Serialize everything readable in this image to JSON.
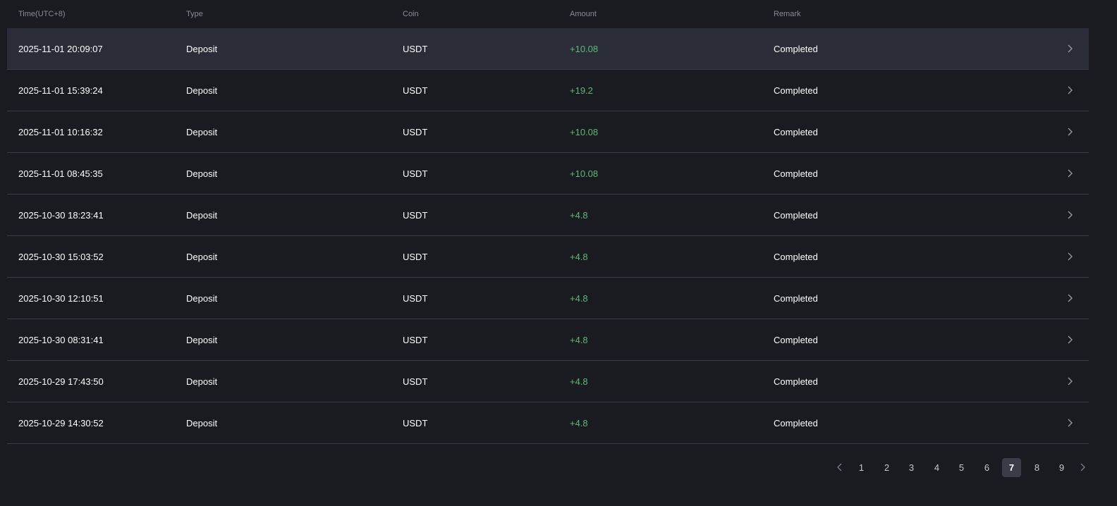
{
  "headers": {
    "time": "Time(UTC+8)",
    "type": "Type",
    "coin": "Coin",
    "amount": "Amount",
    "remark": "Remark"
  },
  "rows": [
    {
      "time": "2025-11-01 20:09:07",
      "type": "Deposit",
      "coin": "USDT",
      "amount": "+10.08",
      "remark": "Completed"
    },
    {
      "time": "2025-11-01 15:39:24",
      "type": "Deposit",
      "coin": "USDT",
      "amount": "+19.2",
      "remark": "Completed"
    },
    {
      "time": "2025-11-01 10:16:32",
      "type": "Deposit",
      "coin": "USDT",
      "amount": "+10.08",
      "remark": "Completed"
    },
    {
      "time": "2025-11-01 08:45:35",
      "type": "Deposit",
      "coin": "USDT",
      "amount": "+10.08",
      "remark": "Completed"
    },
    {
      "time": "2025-10-30 18:23:41",
      "type": "Deposit",
      "coin": "USDT",
      "amount": "+4.8",
      "remark": "Completed"
    },
    {
      "time": "2025-10-30 15:03:52",
      "type": "Deposit",
      "coin": "USDT",
      "amount": "+4.8",
      "remark": "Completed"
    },
    {
      "time": "2025-10-30 12:10:51",
      "type": "Deposit",
      "coin": "USDT",
      "amount": "+4.8",
      "remark": "Completed"
    },
    {
      "time": "2025-10-30 08:31:41",
      "type": "Deposit",
      "coin": "USDT",
      "amount": "+4.8",
      "remark": "Completed"
    },
    {
      "time": "2025-10-29 17:43:50",
      "type": "Deposit",
      "coin": "USDT",
      "amount": "+4.8",
      "remark": "Completed"
    },
    {
      "time": "2025-10-29 14:30:52",
      "type": "Deposit",
      "coin": "USDT",
      "amount": "+4.8",
      "remark": "Completed"
    }
  ],
  "pagination": {
    "pages": [
      "1",
      "2",
      "3",
      "4",
      "5",
      "6",
      "7",
      "8",
      "9"
    ],
    "current": "7",
    "prev_icon": "chevron-left-icon",
    "next_icon": "chevron-right-icon"
  },
  "colors": {
    "background": "#1a1b20",
    "highlight_row": "#2a2d37",
    "positive_amount": "#5fb87a",
    "divider": "#3a3c44"
  }
}
